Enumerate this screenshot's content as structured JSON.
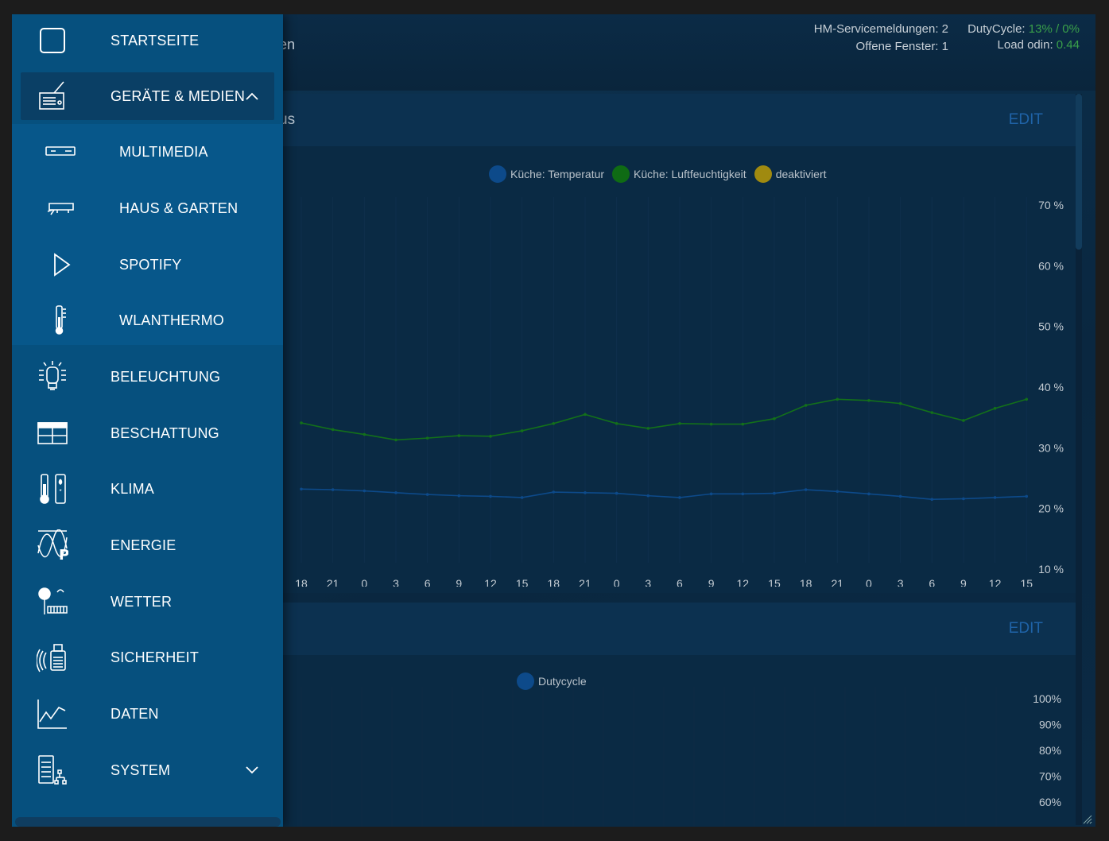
{
  "header": {
    "title_fragment": "en",
    "service_messages_label": "HM-Servicemeldungen: 2",
    "open_windows_label": "Offene Fenster: 1",
    "dutycycle_label": "DutyCycle:",
    "dutycycle_value": "13% / 0%",
    "load_label": "Load odin:",
    "load_value": "0.44"
  },
  "card1": {
    "title_fragment": "us",
    "edit_label": "EDIT"
  },
  "card2": {
    "edit_label": "EDIT"
  },
  "colors": {
    "temperature": "#0d4a8a",
    "humidity": "#0f6b14",
    "deactivated": "#a08a10",
    "dutycycle": "#0d4a8a"
  },
  "chart_data": [
    {
      "type": "line",
      "x": [
        "18",
        "21",
        "0",
        "3",
        "6",
        "9",
        "12",
        "15",
        "18",
        "21",
        "0",
        "3",
        "6",
        "9",
        "12",
        "15",
        "18",
        "21",
        "0",
        "3",
        "6",
        "9",
        "12",
        "15"
      ],
      "series": [
        {
          "name": "Küche: Temperatur",
          "values": [
            23.2,
            23.1,
            22.9,
            22.6,
            22.3,
            22.1,
            22.0,
            21.8,
            22.7,
            22.6,
            22.5,
            22.1,
            21.8,
            22.4,
            22.4,
            22.5,
            23.1,
            22.8,
            22.4,
            22.0,
            21.5,
            21.6,
            21.8,
            22.0
          ]
        },
        {
          "name": "Küche: Luftfeuchtigkeit",
          "values": [
            34.1,
            33.0,
            32.2,
            31.3,
            31.6,
            32.0,
            31.9,
            32.8,
            34.0,
            35.5,
            34.0,
            33.2,
            34.0,
            33.9,
            33.9,
            34.8,
            37.0,
            38.0,
            37.8,
            37.3,
            35.8,
            34.5,
            36.5,
            38.0
          ]
        },
        {
          "name": "deaktiviert",
          "values": []
        }
      ],
      "y_ticks": [
        "70 %",
        "60 %",
        "50 %",
        "40 %",
        "30 %",
        "20 %",
        "10 %"
      ],
      "ylim": [
        10,
        70
      ],
      "grid": true,
      "legend": "top-center"
    },
    {
      "type": "line",
      "series": [
        {
          "name": "Dutycycle",
          "values": []
        }
      ],
      "y_ticks": [
        "100%",
        "90%",
        "80%",
        "70%",
        "60%"
      ],
      "ylim": [
        60,
        100
      ],
      "grid": true,
      "legend": "top-center"
    }
  ],
  "sidebar": {
    "items": [
      {
        "label": "STARTSEITE",
        "icon": "home-square-icon"
      },
      {
        "label": "GERÄTE & MEDIEN",
        "icon": "radio-icon"
      },
      {
        "label": "MULTIMEDIA",
        "icon": "receiver-icon"
      },
      {
        "label": "HAUS & GARTEN",
        "icon": "vacuum-robot-icon"
      },
      {
        "label": "SPOTIFY",
        "icon": "play-icon"
      },
      {
        "label": "WLANTHERMO",
        "icon": "thermometer-icon"
      },
      {
        "label": "BELEUCHTUNG",
        "icon": "light-bulb-icon"
      },
      {
        "label": "BESCHATTUNG",
        "icon": "shutter-icon"
      },
      {
        "label": "KLIMA",
        "icon": "climate-icon"
      },
      {
        "label": "ENERGIE",
        "icon": "energy-icon"
      },
      {
        "label": "WETTER",
        "icon": "weather-icon"
      },
      {
        "label": "SICHERHEIT",
        "icon": "security-icon"
      },
      {
        "label": "DATEN",
        "icon": "chart-icon"
      },
      {
        "label": "SYSTEM",
        "icon": "server-icon"
      }
    ]
  }
}
